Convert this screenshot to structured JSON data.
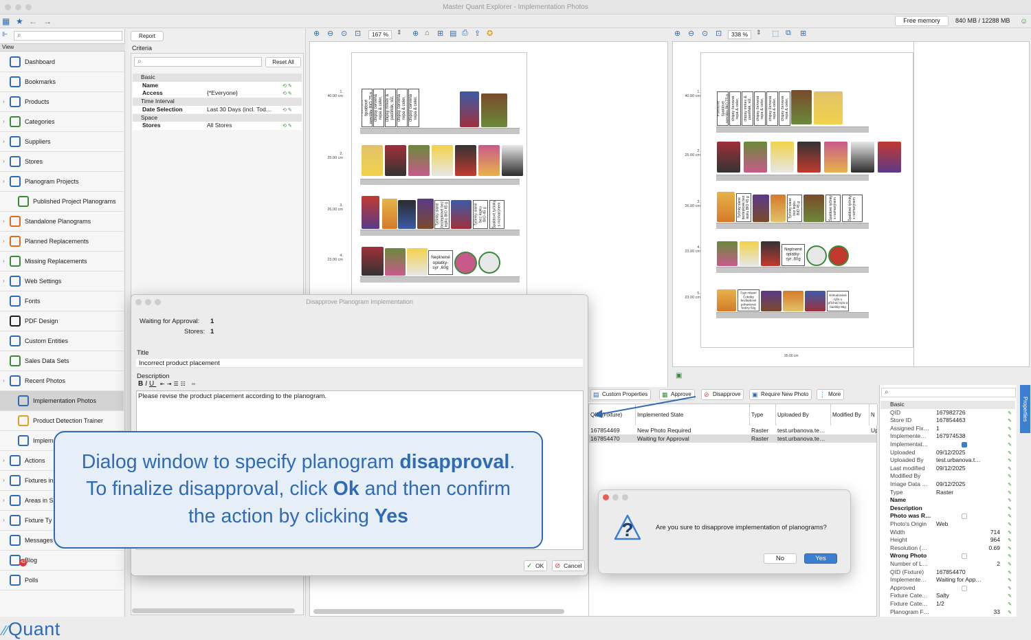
{
  "window": {
    "title": "Master Quant Explorer - Implementation Photos"
  },
  "memory": {
    "button": "Free memory",
    "value": "840 MB / 12288 MB"
  },
  "sidebar": {
    "view_label": "View",
    "items": [
      {
        "label": "Dashboard",
        "icon": "dashboard-icon"
      },
      {
        "label": "Bookmarks",
        "icon": "bookmark-icon"
      },
      {
        "label": "Products",
        "icon": "products-icon"
      },
      {
        "label": "Categories",
        "icon": "categories-icon"
      },
      {
        "label": "Suppliers",
        "icon": "suppliers-icon"
      },
      {
        "label": "Stores",
        "icon": "stores-icon"
      },
      {
        "label": "Planogram Projects",
        "icon": "planogram-projects-icon"
      },
      {
        "label": "Published Project Planograms",
        "icon": "published-planograms-icon"
      },
      {
        "label": "Standalone Planograms",
        "icon": "standalone-planograms-icon"
      },
      {
        "label": "Planned Replacements",
        "icon": "planned-replacements-icon"
      },
      {
        "label": "Missing Replacements",
        "icon": "missing-replacements-icon"
      },
      {
        "label": "Web Settings",
        "icon": "globe-icon"
      },
      {
        "label": "Fonts",
        "icon": "fonts-icon"
      },
      {
        "label": "PDF Design",
        "icon": "pdf-icon"
      },
      {
        "label": "Custom Entities",
        "icon": "custom-entities-icon"
      },
      {
        "label": "Sales Data Sets",
        "icon": "sales-data-icon"
      },
      {
        "label": "Recent Photos",
        "icon": "camera-icon"
      },
      {
        "label": "Implementation Photos",
        "icon": "implementation-photos-icon"
      },
      {
        "label": "Product Detection Trainer",
        "icon": "detection-trainer-icon"
      },
      {
        "label": "Implem",
        "icon": "implementation-icon"
      },
      {
        "label": "Actions",
        "icon": "actions-icon"
      },
      {
        "label": "Fixtures in",
        "icon": "fixtures-icon"
      },
      {
        "label": "Areas in S",
        "icon": "areas-icon"
      },
      {
        "label": "Fixture Ty",
        "icon": "fixture-types-icon"
      },
      {
        "label": "Messages",
        "icon": "messages-icon"
      },
      {
        "label": "Blog",
        "icon": "blog-icon"
      },
      {
        "label": "Polls",
        "icon": "polls-icon"
      }
    ],
    "messages_badge": "42",
    "logo": "Quant"
  },
  "criteria": {
    "report_button": "Report",
    "title": "Criteria",
    "reset_button": "Reset All",
    "rows": [
      {
        "group": "Basic"
      },
      {
        "key": "Name",
        "value": ""
      },
      {
        "key": "Access",
        "value": "{*Everyone}"
      },
      {
        "group": "Time Interval"
      },
      {
        "key": "Date Selection",
        "value": "Last 30 Days (incl. Tod…"
      },
      {
        "group": "Space"
      },
      {
        "key": "Stores",
        "value": "All Stores"
      }
    ]
  },
  "left_view": {
    "zoom": "167 %",
    "shelf_labels": [
      "1.\n40.00 cm",
      "2.\n25.00 cm",
      "3.\n26.00 cm",
      "4.\n23.00 cm"
    ],
    "text_products": [
      "Pšeničné\nšpaldové\npreclíky BIO 75 g",
      "Zeleninové\nchipsy červená\nrepa & celer,\nmorská soľ 90 g",
      "Zeleninové\nchipsy mrkev &\npastiňák, sůl,\npepř 90 g",
      "Zeleninové\nchipsy červená\nrepa & celer,\ncedar 90 g",
      "Tyčinky slané\nbezlepkové bez\nlepku BIO 45 g",
      "Tyčinky slané\nbez lepku\nBIO 45 g",
      "Špaldové tyčinky\ns rozmarýnem",
      "Neplnené\noplatky-\nsyr ,60g"
    ]
  },
  "right_view": {
    "zoom": "338 %",
    "shelf_labels": [
      "1.\n40.00 cm",
      "2.\n25.00 cm",
      "3.\n26.00 cm",
      "4.\n23.00 cm",
      "5.\n23.00 cm"
    ],
    "width_label": "95.00 cm",
    "extra_products": [
      "Fajn mlsaní\nČokolky\nbezlepkové\npohankové\nřetězy 50g",
      "Extrudovaná\nrýže s\npříchutí sýra a\nbaziliky 85g"
    ]
  },
  "grid_toolbar": {
    "custom_properties": "Custom Properties",
    "approve": "Approve",
    "disapprove": "Disapprove",
    "require_new_photo": "Require New Photo",
    "more": "More"
  },
  "grid": {
    "columns": [
      "QID (Fixture)",
      "Implemented State",
      "Type",
      "Uploaded By",
      "Modified By",
      "N"
    ],
    "rows": [
      [
        "167854469",
        "New Photo Required",
        "Raster",
        "test.urbanova.te…",
        "",
        "Up"
      ],
      [
        "167854470",
        "Waiting for Approval",
        "Raster",
        "test.urbanova.te…",
        "",
        ""
      ]
    ]
  },
  "properties": {
    "tab_label": "Properties",
    "rows": [
      {
        "group": "Basic"
      },
      {
        "key": "QID",
        "value": "167982726"
      },
      {
        "key": "Store ID",
        "value": "167854463"
      },
      {
        "key": "Assigned Fix…",
        "value": "1"
      },
      {
        "key": "Implemente…",
        "value": "167974538"
      },
      {
        "key": "Implementat…",
        "value": "",
        "check": true
      },
      {
        "key": "Uploaded",
        "value": "09/12/2025"
      },
      {
        "key": "Uploaded By",
        "value": "test.urbanova.t…"
      },
      {
        "key": "Last modified",
        "value": "09/12/2025"
      },
      {
        "key": "Modified By",
        "value": ""
      },
      {
        "key": "Image Data …",
        "value": "09/12/2025"
      },
      {
        "key": "Type",
        "value": "Raster"
      },
      {
        "key": "Name",
        "value": "",
        "bold": true
      },
      {
        "key": "Description",
        "value": "",
        "bold": true
      },
      {
        "key": "Photo was R…",
        "value": "",
        "bold": true,
        "check": false
      },
      {
        "key": "Photo's Origin",
        "value": "Web"
      },
      {
        "key": "Width",
        "value": "714",
        "right": true
      },
      {
        "key": "Height",
        "value": "964",
        "right": true
      },
      {
        "key": "Resolution (…",
        "value": "0.69",
        "right": true
      },
      {
        "key": "Wrong Photo",
        "value": "",
        "bold": true,
        "check": false
      },
      {
        "key": "Number of L…",
        "value": "2",
        "right": true
      },
      {
        "key": "QID (Fixture)",
        "value": "167854470"
      },
      {
        "key": "Implemente…",
        "value": "Waiting for App…"
      },
      {
        "key": "Approved",
        "value": "",
        "check": false
      },
      {
        "key": "Fixture Cate…",
        "value": "Salty"
      },
      {
        "key": "Fixture Cate…",
        "value": "1/2"
      },
      {
        "key": "Planogram F…",
        "value": "33",
        "right": true
      }
    ]
  },
  "dialog": {
    "title": "Disapprove Planogram Implementation",
    "waiting_label": "Waiting for Approval:",
    "waiting_value": "1",
    "stores_label": "Stores:",
    "stores_value": "1",
    "title_label": "Title",
    "title_value": "Incorrect product placement",
    "description_label": "Description",
    "description_value": "Please revise the product placement according to the planogram.",
    "ok": "OK",
    "cancel": "Cancel"
  },
  "confirm": {
    "message": "Are you sure to disapprove implementation of planograms?",
    "no": "No",
    "yes": "Yes"
  },
  "callout": {
    "line1_a": "Dialog window to specify planogram ",
    "line1_b": "disapproval",
    "line1_c": ".",
    "line2_a": "To finalize disapproval, click ",
    "line2_b": "Ok",
    "line2_c": " and then confirm",
    "line3_a": "the action by clicking ",
    "line3_b": "Yes"
  },
  "colors": {
    "accent": "#2f6bb3",
    "yes_button": "#3c7fd0",
    "callout_bg": "#e6eef8"
  }
}
